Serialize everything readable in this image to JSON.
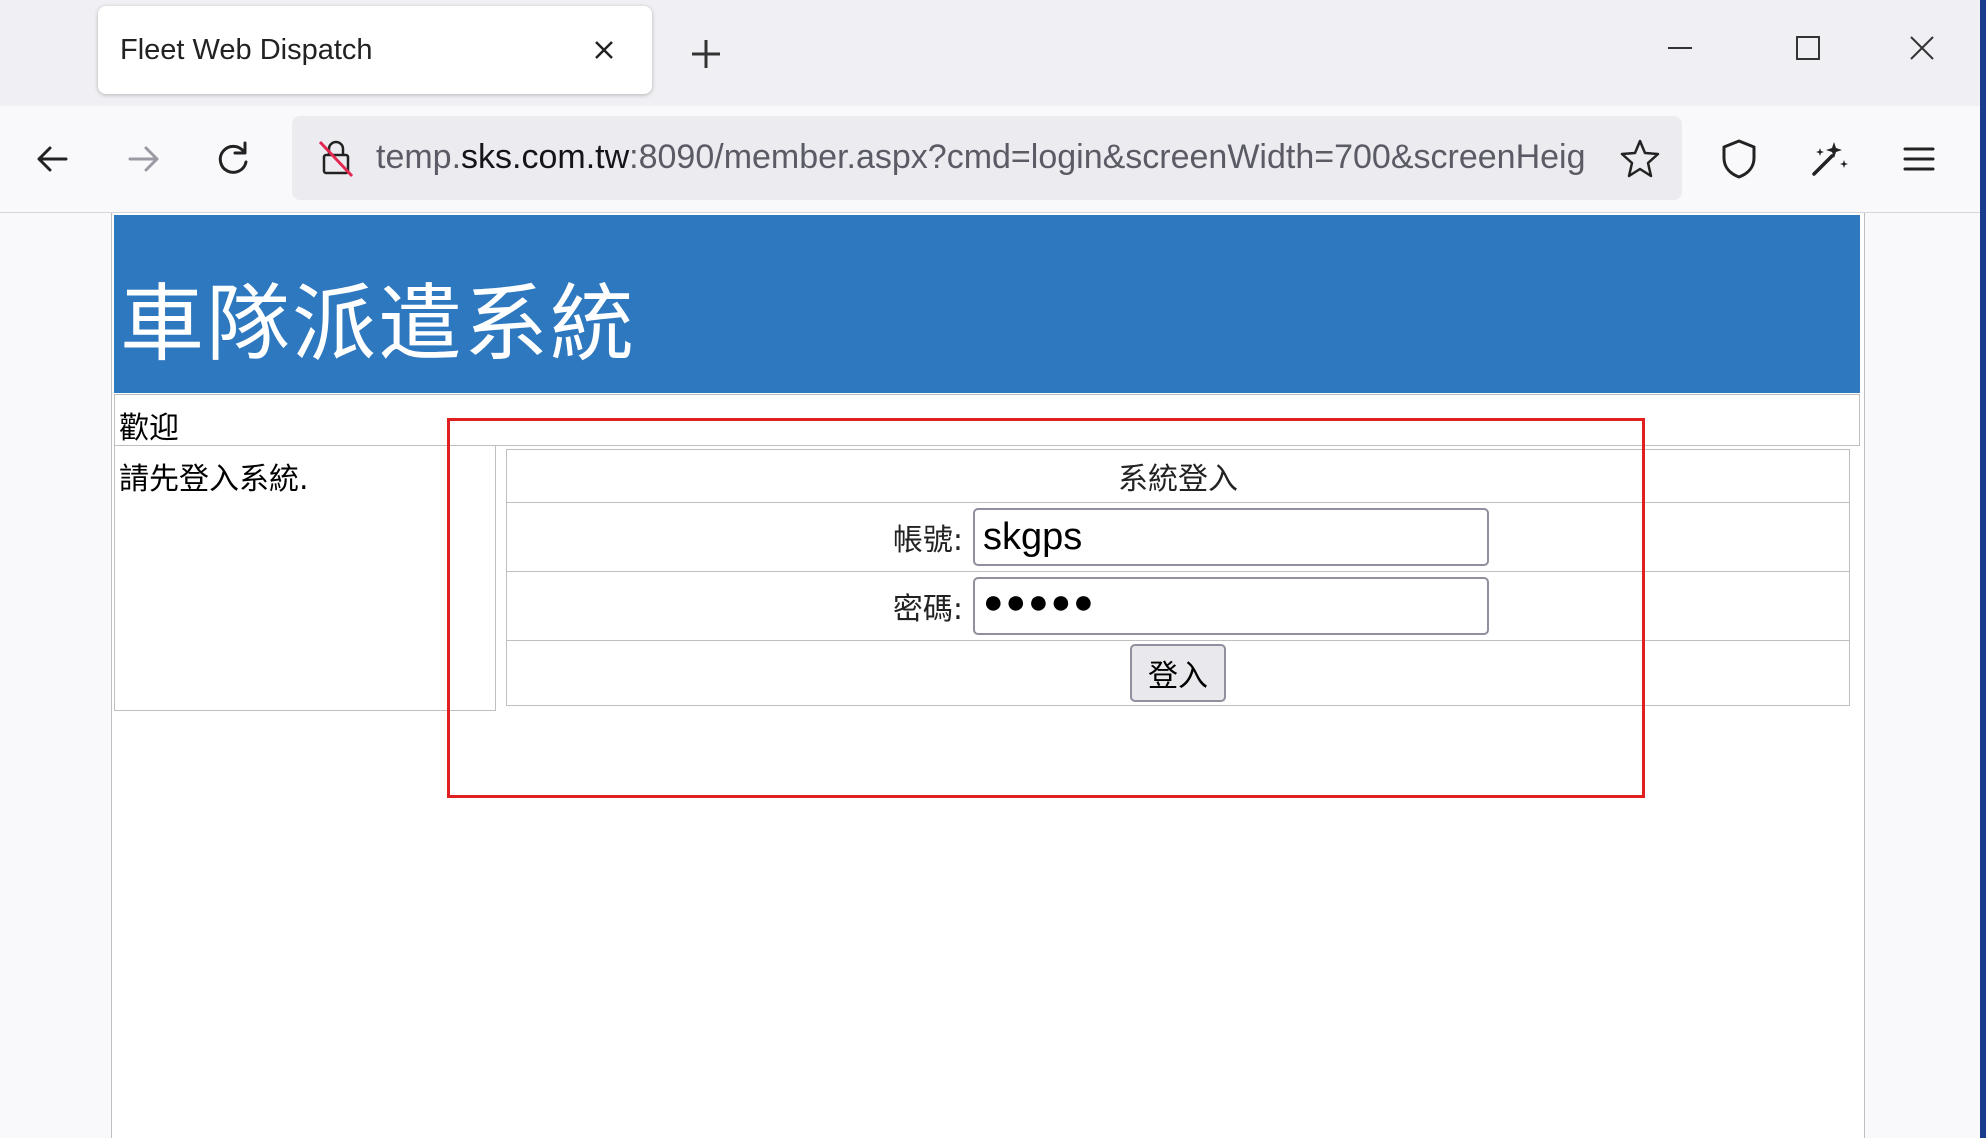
{
  "browser": {
    "tab": {
      "title": "Fleet Web Dispatch"
    },
    "url": {
      "prefix": "temp.",
      "host": "sks.com.tw",
      "rest": ":8090/member.aspx?cmd=login&screenWidth=700&screenHeig"
    },
    "icons": {
      "close_tab": "close-icon",
      "new_tab": "plus-icon",
      "minimize": "minimize-icon",
      "maximize": "maximize-icon",
      "close_window": "close-icon",
      "back": "back-arrow-icon",
      "forward": "forward-arrow-icon",
      "reload": "reload-icon",
      "insecure_lock": "insecure-lock-icon",
      "bookmark": "star-icon",
      "shield": "shield-icon",
      "extensions": "extensions-icon",
      "menu": "hamburger-menu-icon"
    }
  },
  "page": {
    "header_title": "車隊派遣系統",
    "welcome": "歡迎",
    "left_message": "請先登入系統.",
    "login": {
      "title": "系統登入",
      "account_label": "帳號:",
      "account_value": "skgps",
      "password_label": "密碼:",
      "password_value": "●●●●●",
      "submit_label": "登入"
    }
  },
  "colors": {
    "header_bg": "#2e78c0",
    "highlight_box": "#e02020"
  }
}
